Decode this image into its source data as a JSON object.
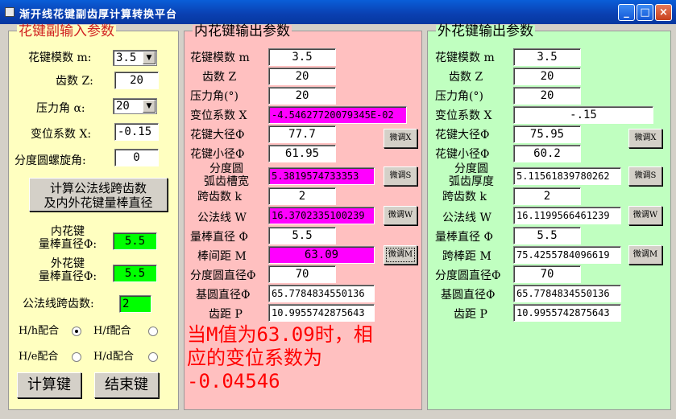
{
  "window": {
    "title": "渐开线花键副齿厚计算转换平台",
    "controls": {
      "minimize": "_",
      "maximize": "□",
      "close": "×"
    }
  },
  "input_panel": {
    "legend": "花键副输入参数",
    "module_label": "花键模数 m:",
    "module_value": "3.5",
    "teeth_label": "齿数 Z:",
    "teeth_value": "20",
    "pressure_label": "压力角 α:",
    "pressure_value": "20",
    "shift_label": "变位系数 X:",
    "shift_value": "-0.15",
    "helix_label": "分度圆螺旋角:",
    "helix_value": "0",
    "calc_button_line1": "计算公法线跨齿数",
    "calc_button_line2": "及内外花键量棒直径",
    "inner_rod_label_line1": "内花键",
    "inner_rod_label_line2": "量棒直径Φ:",
    "inner_rod_value": "5.5",
    "outer_rod_label_line1": "外花键",
    "outer_rod_label_line2": "量棒直径Φ:",
    "outer_rod_value": "5.5",
    "span_label": "公法线跨齿数:",
    "span_value": "2",
    "fit_hh": "H/h配合",
    "fit_hf": "H/f配合",
    "fit_he": "H/e配合",
    "fit_hd": "H/d配合",
    "compute_button": "计算键",
    "exit_button": "结束键"
  },
  "inner_panel": {
    "legend": "内花键输出参数",
    "module_label": "花键模数 m",
    "module_value": "3.5",
    "teeth_label": "齿数 Z",
    "teeth_value": "20",
    "pressure_label": "压力角(°)",
    "pressure_value": "20",
    "shift_label": "变位系数 X",
    "shift_value": "-4.54627720079345E-02",
    "major_label": "花键大径Φ",
    "major_value": "77.7",
    "minor_label": "花键小径Φ",
    "minor_value": "61.95",
    "arc_label_line1": "分度圆",
    "arc_label_line2": "弧齿槽宽",
    "arc_value": "5.3819574733353",
    "span_label": "跨齿数 k",
    "span_value": "2",
    "wline_label": "公法线 W",
    "wline_value": "16.3702335100239",
    "rod_label": "量棒直径 Φ",
    "rod_value": "5.5",
    "rod_distance_label": "棒间距 M",
    "rod_distance_value": "63.09",
    "pitch_label": "分度圆直径Φ",
    "pitch_value": "70",
    "base_label": "基圆直径Φ",
    "base_value": "65.7784834550136",
    "tooth_pitch_label": "齿距 P",
    "tooth_pitch_value": "10.9955742875643",
    "adjust_x": "微调X",
    "adjust_s": "微调S",
    "adjust_w": "微调W",
    "adjust_m": "微调M"
  },
  "outer_panel": {
    "legend": "外花键输出参数",
    "module_label": "花键模数 m",
    "module_value": "3.5",
    "teeth_label": "齿数 Z",
    "teeth_value": "20",
    "pressure_label": "压力角(°)",
    "pressure_value": "20",
    "shift_label": "变位系数 X",
    "shift_value": "-.15",
    "major_label": "花键大径Φ",
    "major_value": "75.95",
    "minor_label": "花键小径Φ",
    "minor_value": "60.2",
    "arc_label_line1": "分度圆",
    "arc_label_line2": "弧齿厚度",
    "arc_value": "5.11561839780262",
    "span_label": "跨齿数 k",
    "span_value": "2",
    "wline_label": "公法线 W",
    "wline_value": "16.1199566461239",
    "rod_label": "量棒直径 Φ",
    "rod_value": "5.5",
    "rod_distance_label": "跨棒距 M",
    "rod_distance_value": "75.4255784096619",
    "pitch_label": "分度圆直径Φ",
    "pitch_value": "70",
    "base_label": "基圆直径Φ",
    "base_value": "65.7784834550136",
    "tooth_pitch_label": "齿距 P",
    "tooth_pitch_value": "10.9955742875643",
    "adjust_x": "微调X",
    "adjust_s": "微调S",
    "adjust_w": "微调W",
    "adjust_m": "微调M"
  },
  "result_note": {
    "line1": "当M值为63.09时，相",
    "line2": "应的变位系数为",
    "line3": "-0.04546"
  },
  "colors": {
    "input_bg": "#ffffc0",
    "inner_bg": "#ffc0c0",
    "outer_bg": "#c0ffc0",
    "highlight_magenta": "#ff00ff",
    "highlight_green": "#00ff00",
    "note_red": "#ff0000"
  }
}
